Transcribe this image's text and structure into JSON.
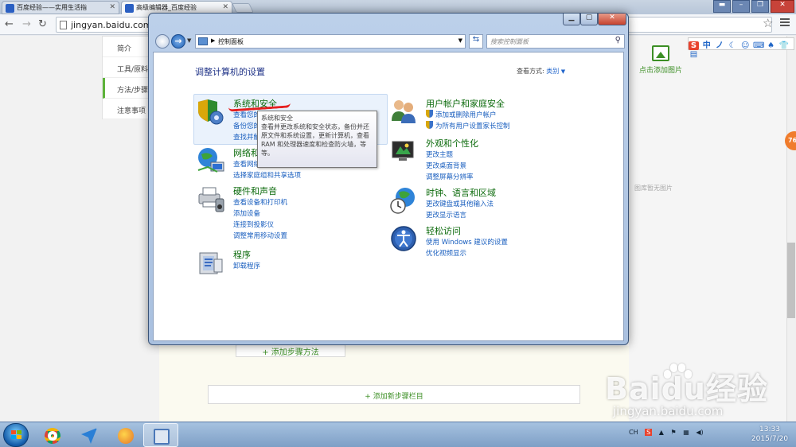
{
  "browser": {
    "tabs": [
      {
        "title": "百度经验——实用生活指",
        "active": false
      },
      {
        "title": "高级编辑器_百度经验",
        "active": true
      }
    ],
    "address": "jingyan.baidu.com",
    "window_buttons": {
      "min": "–",
      "max": "❐",
      "close": "✕"
    }
  },
  "ime": {
    "items": [
      "S",
      "中",
      "ノ",
      "☾",
      "☺",
      "⌨",
      "♠",
      "👕",
      "▤"
    ]
  },
  "webpage": {
    "leftnav": [
      "简介",
      "工具/原料",
      "方法/步骤",
      "注意事项"
    ],
    "add_step_label": "+ 添加步骤方法",
    "add_section_label": "+ 添加新步骤栏目",
    "image_add_label": "点击添加图片",
    "no_image_label": "图库暂无图片",
    "badge": "76",
    "watermark": "Baidu经验",
    "watermark_url": "jingyan.baidu.com"
  },
  "control_panel": {
    "breadcrumb": "控制面板",
    "search_placeholder": "搜索控制面板",
    "heading": "调整计算机的设置",
    "view_by_label": "查看方式:",
    "view_by_value": "类别",
    "categories_left": [
      {
        "title": "系统和安全",
        "links": [
          "查看您的",
          "备份您的",
          "查找并解"
        ],
        "icon": "shield-icon"
      },
      {
        "title": "网络和",
        "links": [
          "查看网络状态和任务",
          "选择家庭组和共享选项"
        ],
        "icon": "network-icon"
      },
      {
        "title": "硬件和声音",
        "links": [
          "查看设备和打印机",
          "添加设备",
          "连接到投影仪",
          "调整常用移动设置"
        ],
        "icon": "printer-icon"
      },
      {
        "title": "程序",
        "links": [
          "卸载程序"
        ],
        "icon": "programs-icon"
      }
    ],
    "categories_right": [
      {
        "title": "用户帐户和家庭安全",
        "links": [
          "添加或删除用户帐户",
          "为所有用户设置家长控制"
        ],
        "icon": "users-icon"
      },
      {
        "title": "外观和个性化",
        "links": [
          "更改主题",
          "更改桌面背景",
          "调整屏幕分辨率"
        ],
        "icon": "appearance-icon"
      },
      {
        "title": "时钟、语言和区域",
        "links": [
          "更改键盘或其他输入法",
          "更改显示语言"
        ],
        "icon": "clock-globe-icon"
      },
      {
        "title": "轻松访问",
        "links": [
          "使用 Windows 建议的设置",
          "优化视频显示"
        ],
        "icon": "ease-of-access-icon"
      }
    ],
    "tooltip": {
      "title": "系统和安全",
      "body": "查看并更改系统和安全状态，备份并还原文件和系统设置，更新计算机，查看 RAM 和处理器速度和检查防火墙，等等。"
    }
  },
  "taskbar": {
    "apps": [
      "chrome-icon",
      "bird-icon",
      "paint-icon",
      "control-panel-icon"
    ],
    "tray": [
      "CH",
      "S"
    ],
    "time": "13:33",
    "date": "2015/7/20"
  }
}
